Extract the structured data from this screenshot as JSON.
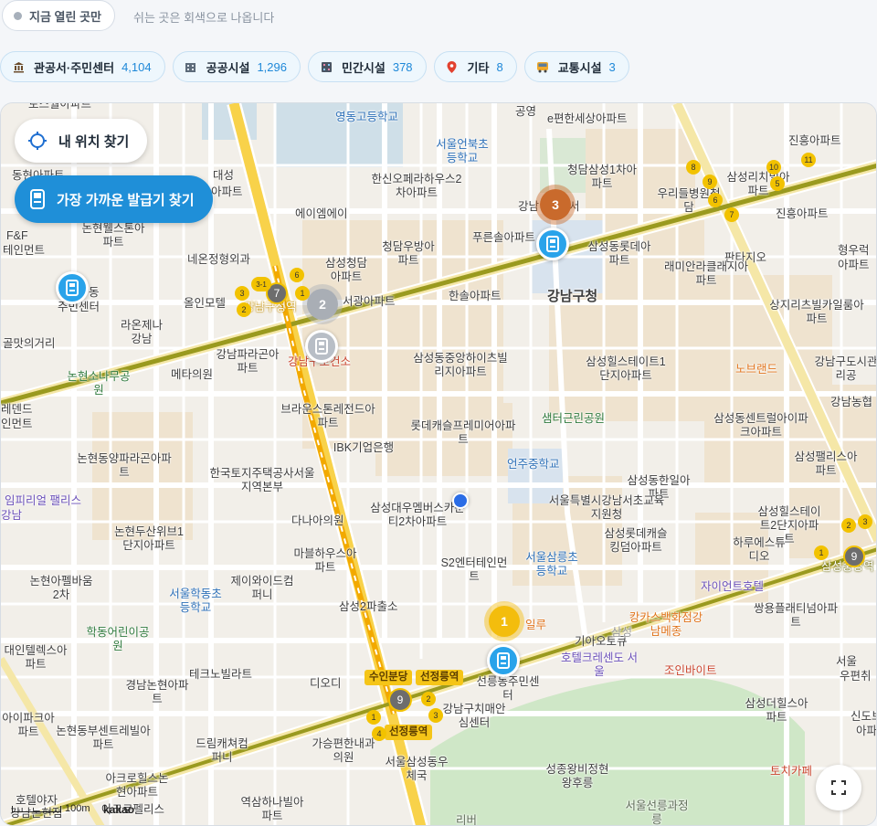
{
  "filter": {
    "open_now_label": "지금 열린 곳만",
    "closed_hint": "쉬는 곳은 회색으로 나옵니다"
  },
  "categories": [
    {
      "label": "관공서·주민센터",
      "count": "4,104",
      "icon": "government-building-icon"
    },
    {
      "label": "공공시설",
      "count": "1,296",
      "icon": "public-facility-icon"
    },
    {
      "label": "민간시설",
      "count": "378",
      "icon": "private-facility-icon"
    },
    {
      "label": "기타",
      "count": "8",
      "icon": "pin-icon"
    },
    {
      "label": "교통시설",
      "count": "3",
      "icon": "bus-icon"
    }
  ],
  "map_buttons": {
    "my_location": "내 위치 찾기",
    "nearest_kiosk": "가장 가까운 발급기 찾기"
  },
  "clusters": [
    {
      "count": "3",
      "color": "#c96a2c"
    },
    {
      "count": "2",
      "color": "#a9aeb5"
    },
    {
      "count": "1",
      "color": "#f3bd0d"
    }
  ],
  "map_labels": [
    "토스월아파트",
    "영동고등학교",
    "공영",
    "e편한세상아파트",
    "서울언북초등학교",
    "진흥아파트",
    "동현아파트",
    "대성",
    "아파트",
    "한신오페라하우스2차아파트",
    "청담삼성1차아파트",
    "우리들병원청담",
    "삼성리치빌아파트",
    "진흥아파트",
    "F&F",
    "테인먼트",
    "에이엠에이",
    "강남",
    "서",
    "판타지오",
    "형우럭",
    "아파트",
    "논현웰스톤아파트",
    "네온정형외과",
    "청담우방아파트",
    "푸른솔아파트",
    "삼성동롯데아파트",
    "삼성청담아파트",
    "래미안라클래시아파트",
    "주민센터",
    "동",
    "올인모텔",
    "강남구청역",
    "서광아파트",
    "한솔아파트",
    "강남구청",
    "상지리츠빌카일룸아파트",
    "라온제나강남",
    "골맛의거리",
    "강남파라곤아파트",
    "메타의원",
    "강남구보건소",
    "삼성동중앙하이츠빌리지아파트",
    "삼성힐스테이트1단지아파트",
    "노브랜드",
    "강남구도시관리공",
    "논현소나무공원",
    "강남농협",
    "레덴드",
    "인먼트",
    "브라운스톤레전드아파트",
    "샘터근린공원",
    "롯데캐슬프레미어아파트",
    "삼성동센트럴아이파크아파트",
    "논현동양파라곤아파트",
    "IBK기업은행",
    "언주중학교",
    "한국토지주택공사서울지역본부",
    "삼성팰리스아파트",
    "임피리얼 팰리스",
    "강남",
    "삼성동한일아파트",
    "서울특별시강남서초교육지원청",
    "삼성대우멤버스카운티2차아파트",
    "다나아의원",
    "삼성힐스테이트2단지아파트",
    "논현두산위브1단지아파트",
    "삼성롯데캐슬킹덤아파트",
    "하루에스튜디오",
    "마블하우스아파트",
    "S2엔터테인먼트",
    "서울삼릉초등학교",
    "삼성중앙역",
    "논현아펠바움2차",
    "제이와이드컴퍼니",
    "서울학동초등학교",
    "자이언트호텔",
    "삼성2파출소",
    "일루",
    "캉카스백화점강남메종",
    "쌍용플래티넘아파트",
    "학동어린이공원",
    "기아오토큐",
    "삼성",
    "대인텔렉스아파트",
    "테크노빌라트",
    "수인분당",
    "선정릉역",
    "호텔크레센도 서울",
    "조인바이트",
    "선릉동주민센터",
    "서울",
    "우편취",
    "경남논현아파트",
    "디오디",
    "삼성더힐스아파트",
    "아이파크아파트",
    "논현동부센트레빌아파트",
    "드림캐쳐컴퍼니",
    "강남구치매안심센터",
    "신도브",
    "아파트",
    "가승편한내과의원",
    "선정릉역",
    "성종왕비정현왕후릉",
    "토치카페",
    "아크로힐스논현아파트",
    "호텔야자",
    "강남논현점",
    "아크로펠리스",
    "역삼하나빌아파트",
    "서울삼성동우체국",
    "서울선릉과정릉",
    "리버"
  ],
  "scale_label": "100m",
  "provider": "kakao",
  "route_numbers": [
    "1",
    "2",
    "3",
    "4",
    "5",
    "6",
    "7",
    "8",
    "9",
    "10",
    "11",
    "3-1"
  ]
}
